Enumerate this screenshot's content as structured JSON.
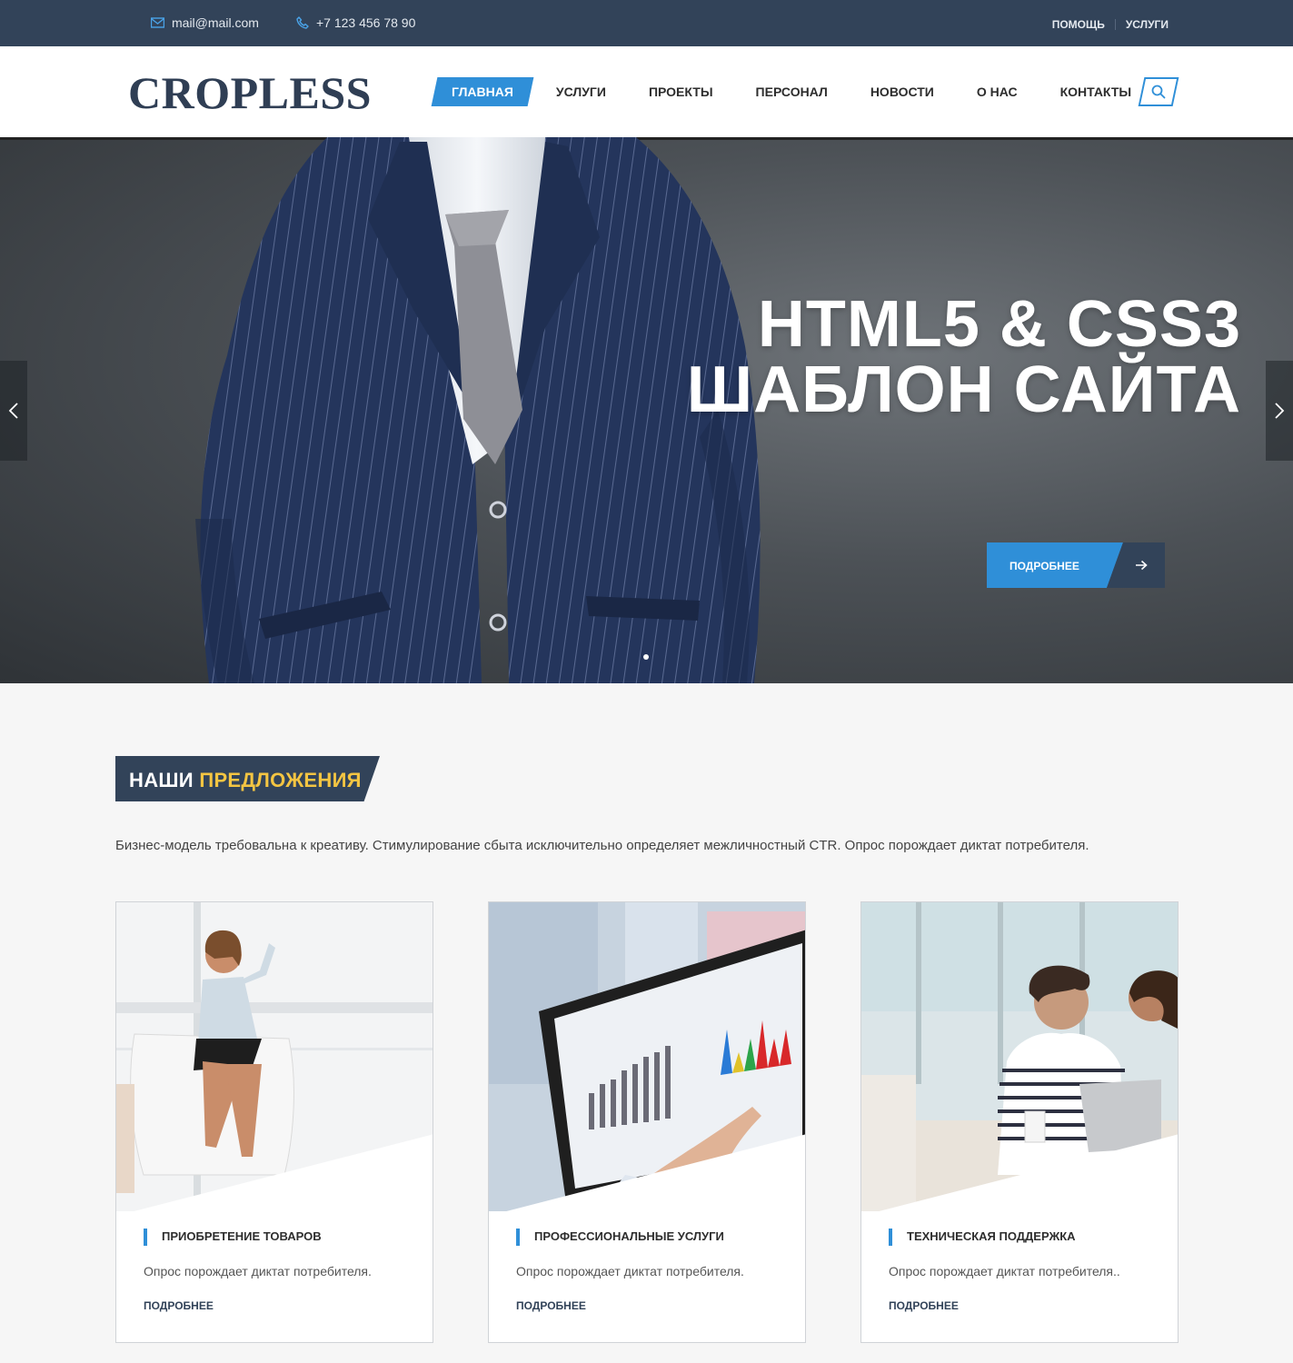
{
  "topbar": {
    "email": "mail@mail.com",
    "phone": "+7 123 456 78 90",
    "links": [
      "ПОМОЩЬ",
      "УСЛУГИ"
    ]
  },
  "header": {
    "logo": "CROPLESS",
    "nav": [
      "ГЛАВНАЯ",
      "УСЛУГИ",
      "ПРОЕКТЫ",
      "ПЕРСОНАЛ",
      "НОВОСТИ",
      "О НАС",
      "КОНТАКТЫ"
    ],
    "active_nav": "ГЛАВНАЯ"
  },
  "hero": {
    "title_line1": "HTML5 & CSS3",
    "title_line2": "ШАБЛОН САЙТА",
    "button_label": "ПОДРОБНЕЕ",
    "slides": 1,
    "active_slide": 1
  },
  "offers": {
    "title_main": "НАШИ",
    "title_accent": "ПРЕДЛОЖЕНИЯ",
    "intro": "Бизнес-модель требовальна к креативу. Стимулирование сбыта исключительно определяет межличностный CTR. Опрос порождает диктат потребителя.",
    "cards": [
      {
        "title": "ПРИОБРЕТЕНИЕ ТОВАРОВ",
        "desc": "Опрос порождает диктат потребителя.",
        "link": "ПОДРОБНЕЕ"
      },
      {
        "title": "ПРОФЕССИОНАЛЬНЫЕ УСЛУГИ",
        "desc": "Опрос порождает диктат потребителя.",
        "link": "ПОДРОБНЕЕ"
      },
      {
        "title": "ТЕХНИЧЕСКАЯ ПОДДЕРЖКА",
        "desc": "Опрос порождает диктат потребителя..",
        "link": "ПОДРОБНЕЕ"
      }
    ]
  },
  "colors": {
    "dark_blue": "#324359",
    "accent_blue": "#2f8fd8",
    "accent_yellow": "#f4c542"
  },
  "icons": [
    "mail-icon",
    "phone-icon",
    "search-icon",
    "chevron-left-icon",
    "chevron-right-icon",
    "arrow-right-icon"
  ]
}
